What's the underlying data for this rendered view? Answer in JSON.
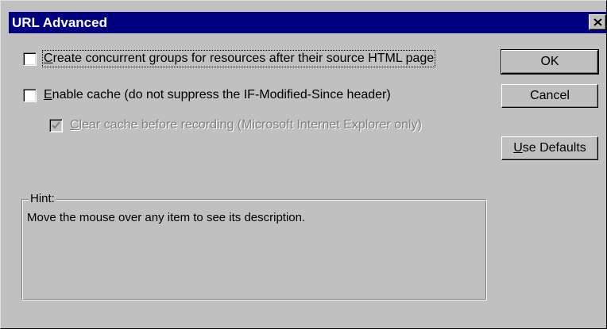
{
  "window": {
    "title": "URL Advanced"
  },
  "options": {
    "concurrent_groups": {
      "label_first": "C",
      "label_rest": "reate concurrent groups for resources after their source HTML page",
      "checked": false
    },
    "enable_cache": {
      "label_first": "E",
      "label_rest": "nable cache (do not suppress the IF-Modified-Since header)",
      "checked": false
    },
    "clear_cache": {
      "label_first": "C",
      "label_rest": "lear cache before recording (Microsoft Internet Explorer only)",
      "checked": true,
      "disabled": true
    }
  },
  "buttons": {
    "ok": "OK",
    "cancel": "Cancel",
    "use_defaults_first": "U",
    "use_defaults_rest": "se Defaults"
  },
  "hint": {
    "legend": "Hint:",
    "text": "Move the mouse over any item to see its description."
  },
  "icons": {
    "close": "close-icon",
    "check": "checkmark-icon"
  }
}
